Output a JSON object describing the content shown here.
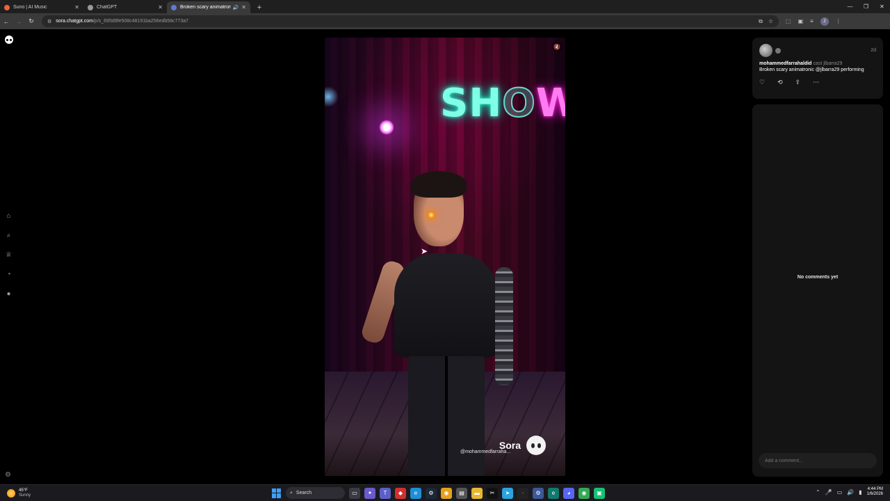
{
  "browser": {
    "tabs": [
      {
        "label": "Suno | AI Music",
        "color": "#e8643c",
        "active": false
      },
      {
        "label": "ChatGPT",
        "color": "#9a9a9a",
        "active": false
      },
      {
        "label": "Broken scary animatronic @",
        "color": "#5b7bd5",
        "active": true
      }
    ],
    "new_tab": "+",
    "url_domain": "sora.chatgpt.com",
    "url_path": "/p/s_695d9fe508c48191ba256edb58c773a7"
  },
  "sidebar": {
    "icons": [
      "home-icon",
      "search-icon",
      "trophy-icon",
      "notification-icon",
      "profile-icon"
    ],
    "bottom_icon": "settings-icon"
  },
  "video": {
    "neon_parts": [
      "SH",
      "O",
      "W"
    ],
    "watermark_brand": "Sora",
    "watermark_user": "@mohammedfarraha..."
  },
  "post": {
    "username": "mohammedfarrahaldid",
    "cast_text": "cast jlbarra29",
    "time": "2d",
    "caption": "Broken scary animatronic @jlbarra29 performing"
  },
  "comments": {
    "empty_text": "No comments yet",
    "input_placeholder": "Add a comment..."
  },
  "taskbar": {
    "weather_temp": "45°F",
    "weather_cond": "Sunny",
    "search_label": "Search",
    "time": "4:44 PM",
    "date": "1/6/2026"
  }
}
